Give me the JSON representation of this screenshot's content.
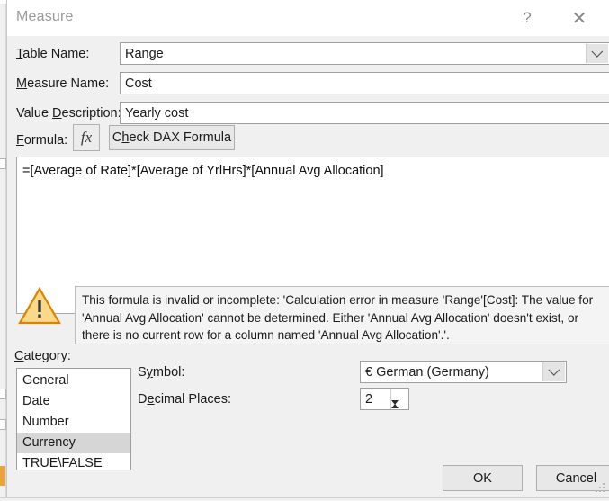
{
  "window": {
    "title": "Measure",
    "help_icon": "?",
    "close_icon": "✕"
  },
  "form": {
    "table_name": {
      "label": "Table Name:",
      "accel": "T",
      "value": "Range"
    },
    "measure_name": {
      "label": "Measure Name:",
      "accel": "M",
      "value": "Cost"
    },
    "value_description": {
      "label": "Value Description:",
      "accel": "D",
      "value": "Yearly cost"
    },
    "formula": {
      "label": "Formula:",
      "accel": "F",
      "fx_icon": "fx",
      "check_button": "Check DAX Formula",
      "check_button_accel": "h",
      "text": "=[Average of Rate]*[Average of YrlHrs]*[Annual Avg Allocation]"
    }
  },
  "warning": {
    "icon": "warning-triangle",
    "message": "This formula is invalid or incomplete: 'Calculation error in measure 'Range'[Cost]: The value for 'Annual Avg Allocation' cannot be determined. Either 'Annual Avg Allocation' doesn't exist, or there is no current row for a column named 'Annual Avg Allocation'.'."
  },
  "category": {
    "label": "Category:",
    "accel": "C",
    "items": [
      {
        "label": "General",
        "selected": false
      },
      {
        "label": "Date",
        "selected": false
      },
      {
        "label": "Number",
        "selected": false
      },
      {
        "label": "Currency",
        "selected": true
      },
      {
        "label": "TRUE\\FALSE",
        "selected": false
      }
    ]
  },
  "format": {
    "symbol": {
      "label": "Symbol:",
      "accel": "y",
      "value": "€ German (Germany)"
    },
    "decimal_places": {
      "label": "Decimal Places:",
      "accel": "e",
      "value": "2"
    }
  },
  "footer": {
    "ok": "OK",
    "cancel": "Cancel"
  },
  "colors": {
    "dialog_bg": "#f0f0f0",
    "titlebar_bg": "#ffffff",
    "warning_border": "#e08000",
    "warning_fill": "#fada8a",
    "selection": "#d6d6d6"
  }
}
